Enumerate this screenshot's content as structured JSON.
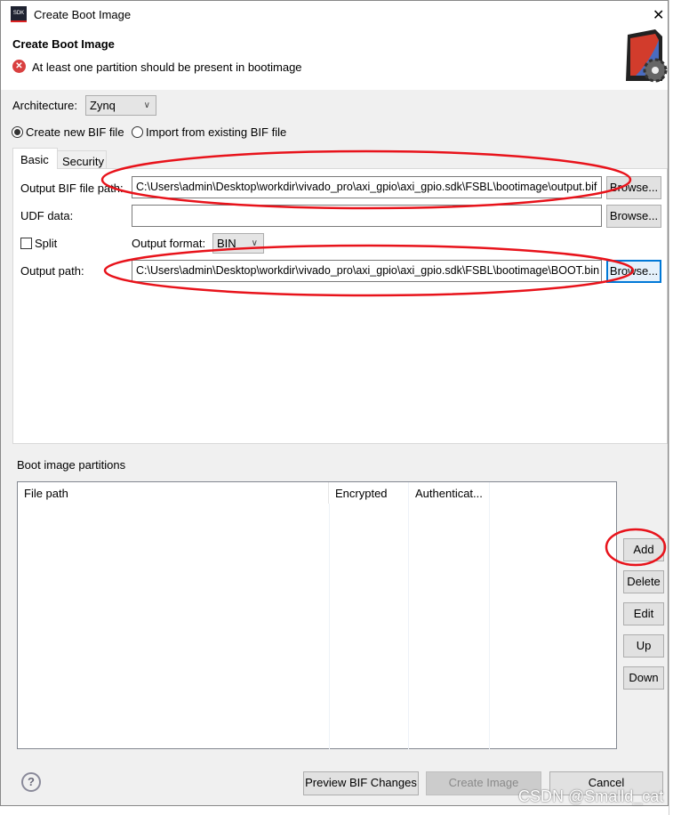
{
  "window": {
    "title": "Create Boot Image",
    "app_badge": "SDK",
    "close": "✕"
  },
  "header": {
    "title": "Create Boot Image",
    "error": "At least one partition should be present in bootimage"
  },
  "architecture": {
    "label": "Architecture:",
    "value": "Zynq"
  },
  "mode": {
    "options": [
      "Create new BIF file",
      "Import from existing BIF file"
    ],
    "selected": 0
  },
  "tabs": [
    {
      "label": "Basic",
      "active": true
    },
    {
      "label": "Security",
      "active": false
    }
  ],
  "basic": {
    "output_bif_label": "Output BIF file path:",
    "output_bif_value": "C:\\Users\\admin\\Desktop\\workdir\\vivado_pro\\axi_gpio\\axi_gpio.sdk\\FSBL\\bootimage\\output.bif",
    "udf_label": "UDF data:",
    "udf_value": "",
    "split_label": "Split",
    "split_checked": false,
    "format_label": "Output format:",
    "format_value": "BIN",
    "output_path_label": "Output path:",
    "output_path_value": "C:\\Users\\admin\\Desktop\\workdir\\vivado_pro\\axi_gpio\\axi_gpio.sdk\\FSBL\\bootimage\\BOOT.bin",
    "browse": "Browse..."
  },
  "partitions": {
    "label": "Boot image partitions",
    "columns": [
      "File path",
      "Encrypted",
      "Authenticat..."
    ],
    "buttons": [
      "Add",
      "Delete",
      "Edit",
      "Up",
      "Down"
    ]
  },
  "footer": {
    "preview": "Preview BIF Changes",
    "create": "Create Image",
    "cancel": "Cancel",
    "help": "?"
  },
  "watermark": "CSDN @Smalld_cat",
  "annotation_color": "#e8131b"
}
